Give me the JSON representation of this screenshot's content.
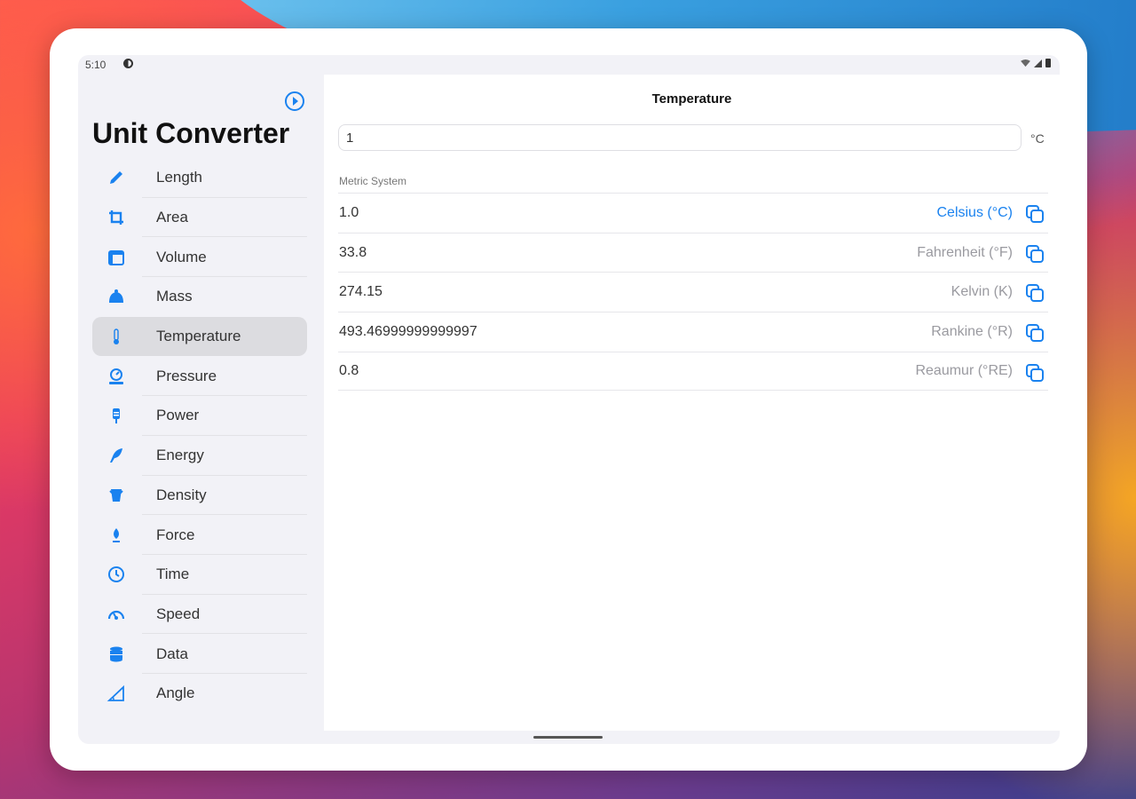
{
  "status": {
    "time": "5:10"
  },
  "sidebar": {
    "title": "Unit Converter",
    "items": [
      {
        "label": "Length",
        "icon": "pencil-icon",
        "active": false
      },
      {
        "label": "Area",
        "icon": "crop-icon",
        "active": false
      },
      {
        "label": "Volume",
        "icon": "window-icon",
        "active": false
      },
      {
        "label": "Mass",
        "icon": "weight-icon",
        "active": false
      },
      {
        "label": "Temperature",
        "icon": "thermometer-icon",
        "active": true
      },
      {
        "label": "Pressure",
        "icon": "gauge-icon",
        "active": false
      },
      {
        "label": "Power",
        "icon": "plug-icon",
        "active": false
      },
      {
        "label": "Energy",
        "icon": "energy-icon",
        "active": false
      },
      {
        "label": "Density",
        "icon": "density-icon",
        "active": false
      },
      {
        "label": "Force",
        "icon": "force-icon",
        "active": false
      },
      {
        "label": "Time",
        "icon": "clock-icon",
        "active": false
      },
      {
        "label": "Speed",
        "icon": "speedometer-icon",
        "active": false
      },
      {
        "label": "Data",
        "icon": "database-icon",
        "active": false
      },
      {
        "label": "Angle",
        "icon": "angle-icon",
        "active": false
      }
    ]
  },
  "main": {
    "title": "Temperature",
    "input_value": "1",
    "input_unit": "°C",
    "section_label": "Metric System",
    "rows": [
      {
        "value": "1.0",
        "unit": "Celsius (°C)",
        "selected": true
      },
      {
        "value": "33.8",
        "unit": "Fahrenheit (°F)",
        "selected": false
      },
      {
        "value": "274.15",
        "unit": "Kelvin (K)",
        "selected": false
      },
      {
        "value": "493.46999999999997",
        "unit": "Rankine (°R)",
        "selected": false
      },
      {
        "value": "0.8",
        "unit": "Reaumur (°RE)",
        "selected": false
      }
    ]
  },
  "colors": {
    "accent": "#1a82ef",
    "sidebar_bg": "#f2f2f7",
    "active_item_bg": "#dcdce0"
  }
}
